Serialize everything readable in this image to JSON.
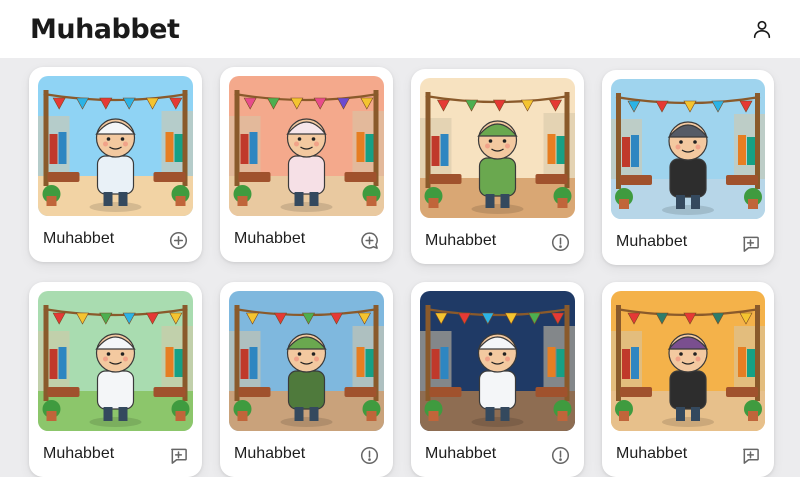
{
  "app": {
    "title": "Muhabbet"
  },
  "header": {
    "profile_icon": "user-icon"
  },
  "cards": [
    {
      "label": "Muhabbet",
      "action_icon": "add-circle-icon",
      "scene": {
        "sky": "#8fd3f4",
        "ground": "#f2d3a4",
        "shirt": "#e9f1f7",
        "hat": "#f4f6f8",
        "bunting": [
          "#e53935",
          "#2bb3e6",
          "#e53935",
          "#2bb3e6",
          "#f4c430",
          "#e53935"
        ]
      }
    },
    {
      "label": "Muhabbet",
      "action_icon": "add-comment-icon",
      "scene": {
        "sky": "#f4a98c",
        "ground": "#e9c9a0",
        "shirt": "#f6e0e6",
        "hat": "#f6e6ea",
        "bunting": [
          "#e74c8b",
          "#4caf50",
          "#f4c430",
          "#e74c8b",
          "#6a4bd1",
          "#f4c430"
        ]
      }
    },
    {
      "label": "Muhabbet",
      "action_icon": "info-circle-icon",
      "scene": {
        "sky": "#f7e2c0",
        "ground": "#d9a774",
        "shirt": "#6aa84f",
        "hat": "#6aa84f",
        "bunting": [
          "#e53935",
          "#4caf50",
          "#e53935",
          "#f4c430",
          "#e53935"
        ]
      }
    },
    {
      "label": "Muhabbet",
      "action_icon": "add-comment-icon",
      "scene": {
        "sky": "#9fd4ee",
        "ground": "#b7d6e8",
        "shirt": "#2d2d2d",
        "hat": "#555b66",
        "bunting": [
          "#2bb3e6",
          "#e53935",
          "#f4c430",
          "#2bb3e6",
          "#e53935"
        ]
      }
    },
    {
      "label": "Muhabbet",
      "action_icon": "add-comment-icon",
      "scene": {
        "sky": "#a9dcb0",
        "ground": "#8cc66b",
        "shirt": "#f4f6f8",
        "hat": "#f4f6f8",
        "bunting": [
          "#e53935",
          "#f4c430",
          "#4caf50",
          "#2bb3e6",
          "#e53935",
          "#f4c430"
        ]
      }
    },
    {
      "label": "Muhabbet",
      "action_icon": "info-circle-icon",
      "scene": {
        "sky": "#7fb8de",
        "ground": "#c9a27b",
        "shirt": "#4f7a3c",
        "hat": "#6aa84f",
        "bunting": [
          "#f4c430",
          "#e53935",
          "#4caf50",
          "#e53935",
          "#f4c430"
        ]
      }
    },
    {
      "label": "Muhabbet",
      "action_icon": "info-circle-icon",
      "scene": {
        "sky": "#1f3a66",
        "ground": "#8e6d52",
        "shirt": "#f4f6f8",
        "hat": "#f4f6f8",
        "bunting": [
          "#f4c430",
          "#e53935",
          "#2bb3e6",
          "#f4c430",
          "#4caf50",
          "#e53935"
        ]
      }
    },
    {
      "label": "Muhabbet",
      "action_icon": "add-comment-icon",
      "scene": {
        "sky": "#f4b24a",
        "ground": "#e7c08b",
        "shirt": "#2d2d2d",
        "hat": "#7a4f8f",
        "bunting": [
          "#e53935",
          "#2e7d6b",
          "#e53935",
          "#2e7d6b",
          "#f4c430"
        ]
      }
    }
  ]
}
